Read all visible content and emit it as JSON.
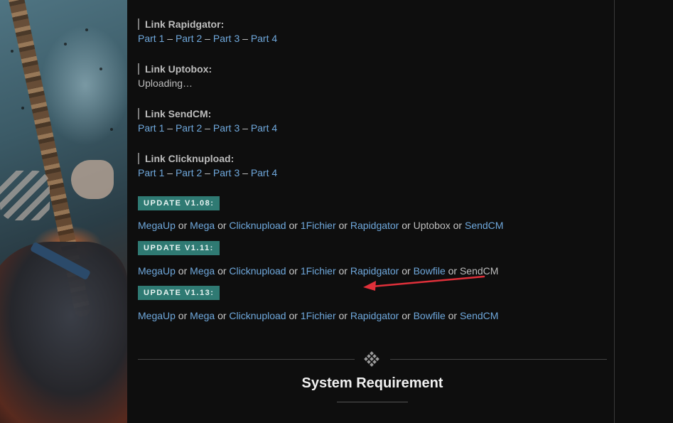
{
  "sections": [
    {
      "heading": "Link Rapidgator",
      "parts": [
        "Part 1",
        "Part 2",
        "Part 3",
        "Part 4"
      ]
    },
    {
      "heading": "Link Uptobox",
      "status": "Uploading…"
    },
    {
      "heading": "Link SendCM",
      "parts": [
        "Part 1",
        "Part 2",
        "Part 3",
        "Part 4"
      ]
    },
    {
      "heading": "Link Clicknupload",
      "parts": [
        "Part 1",
        "Part 2",
        "Part 3",
        "Part 4"
      ]
    }
  ],
  "separators": {
    "dash": " – ",
    "or": " or ",
    "colon": ":"
  },
  "updates": [
    {
      "badge": "UPDATE V1.08:",
      "hosts": [
        {
          "name": "MegaUp",
          "link": true
        },
        {
          "name": "Mega",
          "link": true
        },
        {
          "name": "Clicknupload",
          "link": true
        },
        {
          "name": "1Fichier",
          "link": true
        },
        {
          "name": "Rapidgator",
          "link": true
        },
        {
          "name": "Uptobox",
          "link": false
        },
        {
          "name": "SendCM",
          "link": true
        }
      ]
    },
    {
      "badge": "UPDATE V1.11:",
      "hosts": [
        {
          "name": "MegaUp",
          "link": true
        },
        {
          "name": "Mega",
          "link": true
        },
        {
          "name": "Clicknupload",
          "link": true
        },
        {
          "name": "1Fichier",
          "link": true
        },
        {
          "name": "Rapidgator",
          "link": true
        },
        {
          "name": "Bowfile",
          "link": true
        },
        {
          "name": "SendCM",
          "link": false
        }
      ]
    },
    {
      "badge": "UPDATE V1.13:",
      "hosts": [
        {
          "name": "MegaUp",
          "link": true
        },
        {
          "name": "Mega",
          "link": true
        },
        {
          "name": "Clicknupload",
          "link": true
        },
        {
          "name": "1Fichier",
          "link": true
        },
        {
          "name": "Rapidgator",
          "link": true
        },
        {
          "name": "Bowfile",
          "link": true
        },
        {
          "name": "SendCM",
          "link": true
        }
      ]
    }
  ],
  "system_requirement": {
    "title": "System Requirement"
  },
  "colors": {
    "link": "#6fa8dc",
    "badge": "#2f7a73",
    "arrow": "#e0303a",
    "background": "#0e0e0e"
  },
  "icons": {
    "divider": "diamond-dots-icon",
    "annotation": "red-arrow-icon"
  }
}
